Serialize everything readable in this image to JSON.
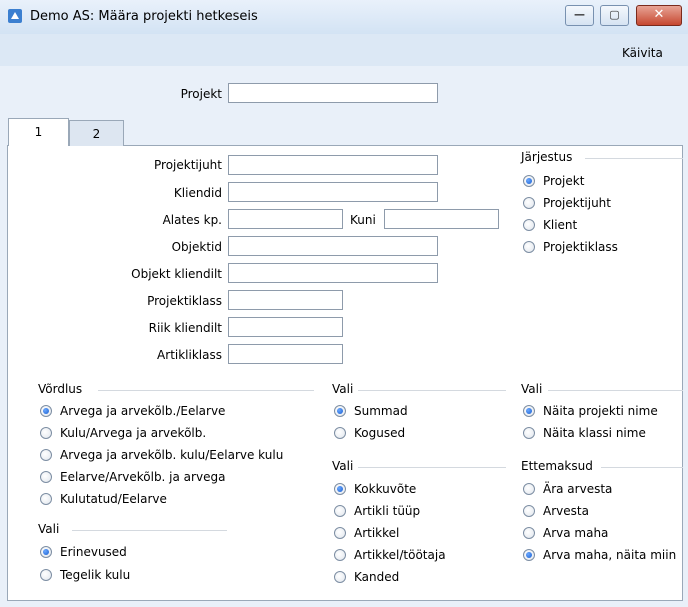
{
  "window": {
    "title": "Demo AS: Määra projekti hetkeseis",
    "minimize": "—",
    "maximize": "▢",
    "close": "✕"
  },
  "menu": {
    "run": "Käivita"
  },
  "header": {
    "project_label": "Projekt",
    "project_value": ""
  },
  "tabs": [
    {
      "label": "1"
    },
    {
      "label": "2"
    }
  ],
  "fields": {
    "projektijuht": "Projektijuht",
    "kliendid": "Kliendid",
    "alates": "Alates kp.",
    "kuni": "Kuni",
    "objektid": "Objektid",
    "objekt_kliendilt": "Objekt kliendilt",
    "projektiklass": "Projektiklass",
    "riik_kliendilt": "Riik kliendilt",
    "artikliklass": "Artikliklass"
  },
  "groups": {
    "jarjestus": {
      "title": "Järjestus",
      "options": [
        "Projekt",
        "Projektijuht",
        "Klient",
        "Projektiklass"
      ],
      "selected": 0
    },
    "vordlus": {
      "title": "Võrdlus",
      "options": [
        "Arvega ja arvekõlb./Eelarve",
        "Kulu/Arvega ja arvekõlb.",
        "Arvega ja arvekõlb. kulu/Eelarve kulu",
        "Eelarve/Arvekõlb. ja arvega",
        "Kulutatud/Eelarve"
      ],
      "selected": 0
    },
    "vali_a": {
      "title": "Vali",
      "options": [
        "Erinevused",
        "Tegelik kulu"
      ],
      "selected": 0
    },
    "vali_b": {
      "title": "Vali",
      "options": [
        "Summad",
        "Kogused"
      ],
      "selected": 0
    },
    "vali_c": {
      "title": "Vali",
      "options": [
        "Kokkuvõte",
        "Artikli tüüp",
        "Artikkel",
        "Artikkel/töötaja",
        "Kanded"
      ],
      "selected": 0
    },
    "vali_d": {
      "title": "Vali",
      "options": [
        "Näita projekti nime",
        "Näita klassi nime"
      ],
      "selected": 0
    },
    "ettemaksud": {
      "title": "Ettemaksud",
      "options": [
        "Ära arvesta",
        "Arvesta",
        "Arva maha",
        "Arva maha, näita miin"
      ],
      "selected": 3
    }
  }
}
